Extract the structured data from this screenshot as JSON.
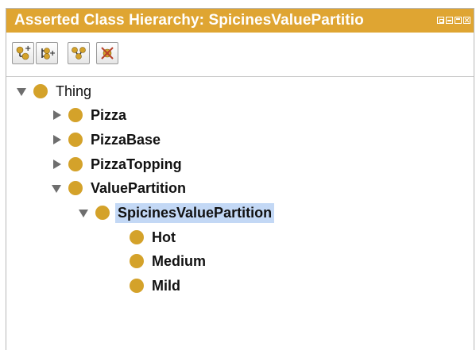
{
  "panel": {
    "title": "Asserted Class Hierarchy: SpicinesValuePartitio",
    "window_controls": [
      "float-icon",
      "minimize-icon",
      "maximize-icon",
      "close-icon"
    ],
    "accent_color": "#dfa532"
  },
  "toolbar": {
    "buttons": [
      {
        "name": "add-subclass-button",
        "icon": "add-subclass-icon"
      },
      {
        "name": "add-sibling-class-button",
        "icon": "add-sibling-class-icon"
      },
      {
        "name": "create-hierarchy-button",
        "icon": "hierarchy-icon"
      },
      {
        "name": "delete-class-button",
        "icon": "delete-class-icon"
      }
    ]
  },
  "tree": {
    "selected": "SpicinesValuePartition",
    "nodes": [
      {
        "label": "Thing",
        "state": "expanded"
      },
      {
        "label": "Pizza",
        "state": "collapsed"
      },
      {
        "label": "PizzaBase",
        "state": "collapsed"
      },
      {
        "label": "PizzaTopping",
        "state": "collapsed"
      },
      {
        "label": "ValuePartition",
        "state": "expanded"
      },
      {
        "label": "SpicinesValuePartition",
        "state": "expanded"
      },
      {
        "label": "Hot",
        "state": "leaf"
      },
      {
        "label": "Medium",
        "state": "leaf"
      },
      {
        "label": "Mild",
        "state": "leaf"
      }
    ]
  },
  "colors": {
    "class_dot": "#d4a22a",
    "selection": "#c3d8f5"
  }
}
